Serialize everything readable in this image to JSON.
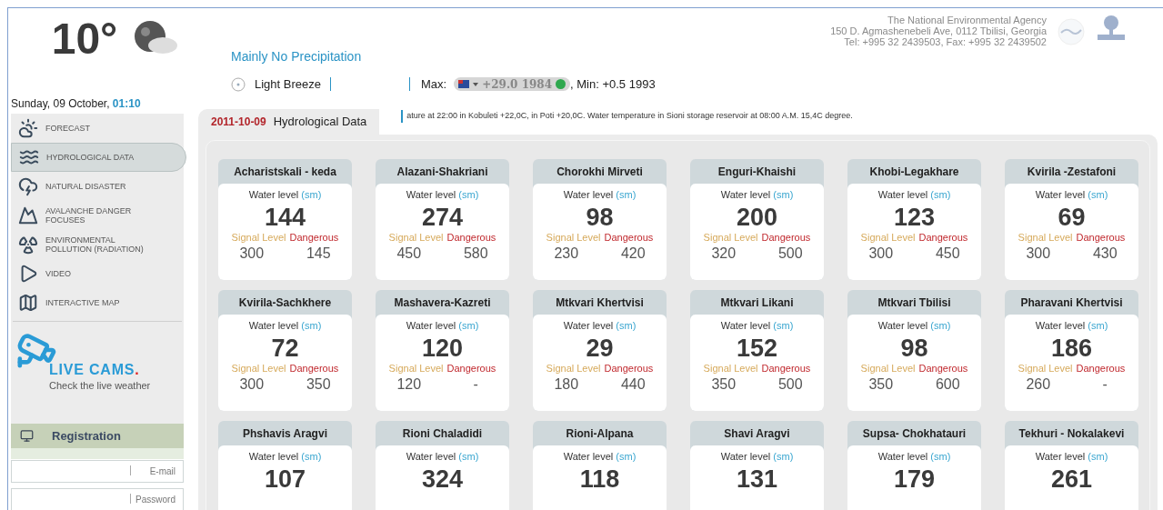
{
  "weather": {
    "temperature": "10°",
    "precipitation": "Mainly No Precipitation",
    "wind": "Light Breeze",
    "max_label": "Max:",
    "max_value": "+29.0 1984",
    "min_text": ", Min: +0.5 1993"
  },
  "date": {
    "text": "Sunday, 09 October,",
    "time": "01:10"
  },
  "agency": {
    "name": "The National Environmental Agency",
    "address": "150 D. Agmashenebeli Ave, 0112 Tbilisi, Georgia",
    "phone": "Tel: +995 32 2439503, Fax: +995 32 2439502"
  },
  "sidebar": {
    "items": [
      {
        "kind": "forecast",
        "label": "FORECAST",
        "selected": false
      },
      {
        "kind": "hydro",
        "label": "HYDROLOGICAL DATA",
        "selected": true
      },
      {
        "kind": "disaster",
        "label": "NATURAL DISASTER",
        "selected": false
      },
      {
        "kind": "avalanche",
        "label": "AVALANCHE DANGER FOCUSES",
        "selected": false
      },
      {
        "kind": "radiation",
        "label": "ENVIRONMENTAL POLLUTION (RADIATION)",
        "selected": false
      },
      {
        "kind": "video",
        "label": "VIDEO",
        "selected": false
      },
      {
        "kind": "map",
        "label": "INTERACTIVE MAP",
        "selected": false
      }
    ],
    "live_cams": {
      "title": "LIVE CAMS",
      "dot": ".",
      "subtitle": "Check the live weather"
    },
    "registration": {
      "title": "Registration",
      "fields": [
        {
          "placeholder": "E-mail"
        },
        {
          "placeholder": "Password"
        }
      ]
    }
  },
  "tab": {
    "date": "2011-10-09",
    "title": "Hydrological Data"
  },
  "ticker": "ature at 22:00 in Kobuleti +22,0C, in Poti +20,0C. Water temperature in Sioni storage reservoir at 08:00 A.M. 15,4C degree.",
  "stations": [
    {
      "name": "Acharistskali - keda",
      "label": "Water level",
      "unit": "(sm)",
      "value": "144",
      "signal_label": "Signal Level",
      "danger_label": "Dangerous",
      "signal": "300",
      "danger": "145"
    },
    {
      "name": "Alazani-Shakriani",
      "label": "Water level",
      "unit": "(sm)",
      "value": "274",
      "signal_label": "Signal Level",
      "danger_label": "Dangerous",
      "signal": "450",
      "danger": "580"
    },
    {
      "name": "Chorokhi Mirveti",
      "label": "Water level",
      "unit": "(sm)",
      "value": "98",
      "signal_label": "Signal Level",
      "danger_label": "Dangerous",
      "signal": "230",
      "danger": "420"
    },
    {
      "name": "Enguri-Khaishi",
      "label": "Water level",
      "unit": "(sm)",
      "value": "200",
      "signal_label": "Signal Level",
      "danger_label": "Dangerous",
      "signal": "320",
      "danger": "500"
    },
    {
      "name": "Khobi-Legakhare",
      "label": "Water level",
      "unit": "(sm)",
      "value": "123",
      "signal_label": "Signal Level",
      "danger_label": "Dangerous",
      "signal": "300",
      "danger": "450"
    },
    {
      "name": "Kvirila -Zestafoni",
      "label": "Water level",
      "unit": "(sm)",
      "value": "69",
      "signal_label": "Signal Level",
      "danger_label": "Dangerous",
      "signal": "300",
      "danger": "430"
    },
    {
      "name": "Kvirila-Sachkhere",
      "label": "Water level",
      "unit": "(sm)",
      "value": "72",
      "signal_label": "Signal Level",
      "danger_label": "Dangerous",
      "signal": "300",
      "danger": "350"
    },
    {
      "name": "Mashavera-Kazreti",
      "label": "Water level",
      "unit": "(sm)",
      "value": "120",
      "signal_label": "Signal Level",
      "danger_label": "Dangerous",
      "signal": "120",
      "danger": "-"
    },
    {
      "name": "Mtkvari Khertvisi",
      "label": "Water level",
      "unit": "(sm)",
      "value": "29",
      "signal_label": "Signal Level",
      "danger_label": "Dangerous",
      "signal": "180",
      "danger": "440"
    },
    {
      "name": "Mtkvari Likani",
      "label": "Water level",
      "unit": "(sm)",
      "value": "152",
      "signal_label": "Signal Level",
      "danger_label": "Dangerous",
      "signal": "350",
      "danger": "500"
    },
    {
      "name": "Mtkvari Tbilisi",
      "label": "Water level",
      "unit": "(sm)",
      "value": "98",
      "signal_label": "Signal Level",
      "danger_label": "Dangerous",
      "signal": "350",
      "danger": "600"
    },
    {
      "name": "Pharavani Khertvisi",
      "label": "Water level",
      "unit": "(sm)",
      "value": "186",
      "signal_label": "Signal Level",
      "danger_label": "Dangerous",
      "signal": "260",
      "danger": "-"
    },
    {
      "name": "Phshavis Aragvi",
      "label": "Water level",
      "unit": "(sm)",
      "value": "107"
    },
    {
      "name": "Rioni Chaladidi",
      "label": "Water level",
      "unit": "(sm)",
      "value": "324"
    },
    {
      "name": "Rioni-Alpana",
      "label": "Water level",
      "unit": "(sm)",
      "value": "118"
    },
    {
      "name": "Shavi Aragvi",
      "label": "Water level",
      "unit": "(sm)",
      "value": "131"
    },
    {
      "name": "Supsa- Chokhatauri",
      "label": "Water level",
      "unit": "(sm)",
      "value": "179"
    },
    {
      "name": "Tekhuri - Nokalakevi",
      "label": "Water level",
      "unit": "(sm)",
      "value": "261"
    }
  ]
}
